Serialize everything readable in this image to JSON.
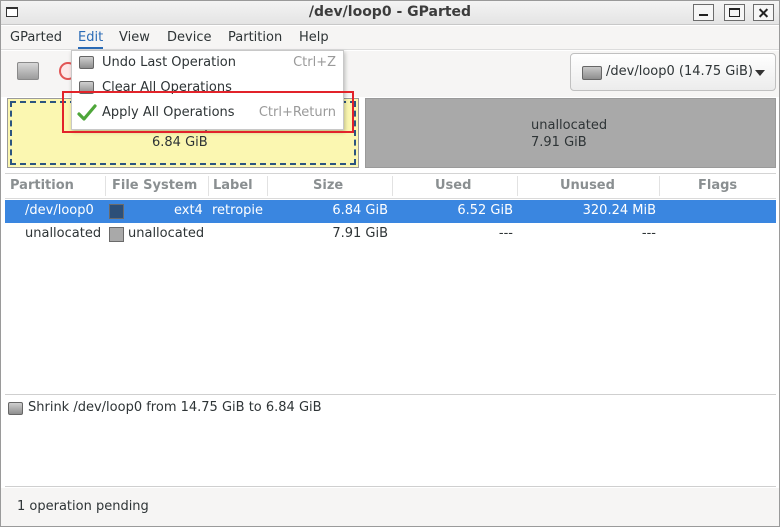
{
  "window": {
    "title": "/dev/loop0 - GParted"
  },
  "menubar": {
    "items": [
      "GParted",
      "Edit",
      "View",
      "Device",
      "Partition",
      "Help"
    ],
    "active": "Edit"
  },
  "edit_menu": {
    "items": [
      {
        "label": "Undo Last Operation",
        "accel": "Ctrl+Z",
        "icon": "undo-icon"
      },
      {
        "label": "Clear All Operations",
        "accel": "",
        "icon": "clear-icon"
      },
      {
        "label": "Apply All Operations",
        "accel": "Ctrl+Return",
        "icon": "checkmark-icon"
      }
    ]
  },
  "device_selector": {
    "value": "/dev/loop0 (14.75 GiB)",
    "icon": "drive-icon"
  },
  "disk_map": {
    "partition": {
      "name": "/dev/loop0",
      "size": "6.84 GiB",
      "color": "#fbf7b1"
    },
    "unallocated": {
      "name": "unallocated",
      "size": "7.91 GiB",
      "color": "#a9a9a9"
    }
  },
  "partition_table": {
    "columns": [
      "Partition",
      "File System",
      "Label",
      "Size",
      "Used",
      "Unused",
      "Flags"
    ],
    "rows": [
      {
        "partition": "/dev/loop0",
        "fs_color": "#2c4f78",
        "filesystem": "ext4",
        "label": "retropie",
        "size": "6.84 GiB",
        "used": "6.52 GiB",
        "unused": "320.24 MiB",
        "flags": ""
      },
      {
        "partition": "unallocated",
        "fs_color": "#a9a9a9",
        "filesystem": "unallocated",
        "label": "",
        "size": "7.91 GiB",
        "used": "---",
        "unused": "---",
        "flags": ""
      }
    ],
    "selected_row_color": "#3a86e0"
  },
  "operations": {
    "items": [
      "Shrink /dev/loop0 from 14.75 GiB to 6.84 GiB"
    ]
  },
  "status": {
    "text": "1 operation pending"
  }
}
